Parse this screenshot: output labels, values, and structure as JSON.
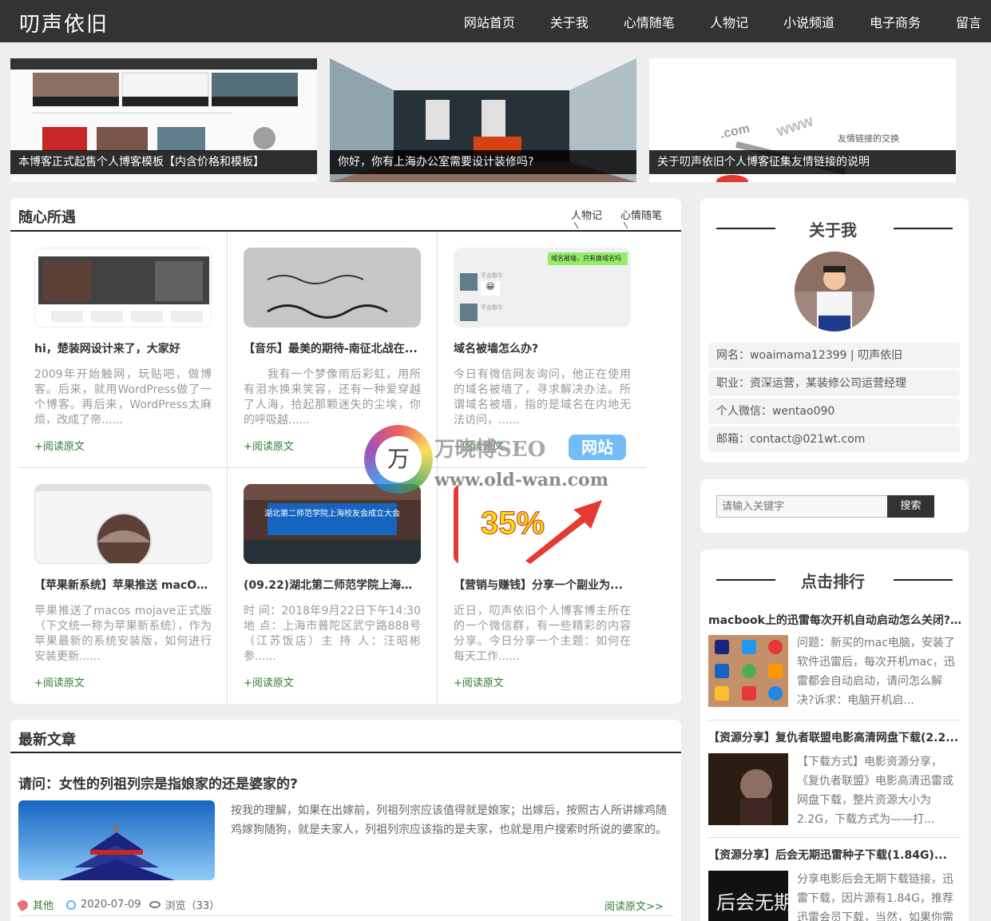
{
  "site": {
    "logo": "叨声依旧"
  },
  "nav": [
    "网站首页",
    "关于我",
    "心情随笔",
    "人物记",
    "小说频道",
    "电子商务",
    "留言"
  ],
  "slides": [
    "本博客正式起售个人博客模板【内含价格和模板】",
    "你好，你有上海办公室需要设计装修吗?",
    "关于叨声依旧个人博客征集友情链接的说明"
  ],
  "slide3_text": {
    "com": ".com",
    "www": "www",
    "label": "友情链接的交换"
  },
  "random": {
    "title": "随心所遇",
    "tabs": [
      "人物记",
      "心情随笔"
    ],
    "read_more": "+阅读原文",
    "cards": [
      {
        "title": "hi，楚装网设计来了，大家好",
        "desc": "2009年开始触网，玩贴吧，做博客。后来，就用WordPress做了一个博客。再后来，WordPress太麻烦，改成了帝......"
      },
      {
        "title": "【音乐】最美的期待-南征北战在...",
        "desc": "　　我有一个梦像雨后彩虹，用所有泪水换来笑容，还有一种爱穿越了人海，拾起那颗迷失的尘埃，你的呼吸越......"
      },
      {
        "title": "域名被墙怎么办?",
        "desc": "今日有微信网友询问，他正在使用的域名被墙了，寻求解决办法。所谓域名被墙，指的是域名在内地无法访问，......"
      },
      {
        "title": "【苹果新系统】苹果推送 macOS...",
        "desc": "苹果推送了macos mojave正式版（下文统一称为苹果新系统），作为苹果最新的系统安装版，如何进行安装更新......"
      },
      {
        "title": "(09.22)湖北第二师范学院上海校...",
        "desc": "时 间：2018年9月22日下午14:30 地 点：上海市普陀区武宁路888号（江苏饭店）主 持 人：汪昭彬 参......"
      },
      {
        "title": "【营销与赚钱】分享一个副业为...",
        "desc": "近日，叨声依旧个人博客博主所在的一个微信群，有一些精彩的内容分享。今日分享一个主题：如何在每天工作......"
      }
    ],
    "chat": {
      "bubble": "域名被墙，只有换域名吗",
      "name1": "不会取牛",
      "name2": "不会取牛",
      "emoji": "😁"
    },
    "temple_banner": "湖北第二师范学院上海校友会成立大会",
    "percent": "35%"
  },
  "latest": {
    "title": "最新文章",
    "post_title": "请问：女性的列祖列宗是指娘家的还是婆家的?",
    "post_desc": "按我的理解，如果在出嫁前，列祖列宗应该值得就是娘家；出嫁后，按照古人所讲嫁鸡随鸡嫁狗随狗，就是夫家人，列祖列宗应该指的是夫家，也就是用户搜索时所说的婆家的。",
    "category": "其他",
    "date": "2020-07-09",
    "views": "浏览（33）",
    "read_more": "阅读原文>>"
  },
  "about": {
    "title": "关于我",
    "rows": [
      "网名：woaimama12399 | 叨声依旧",
      "职业：资深运营，某装修公司运营经理",
      "个人微信：wentao090",
      "邮箱：contact@021wt.com"
    ]
  },
  "search": {
    "placeholder": "请输入关键字",
    "button": "搜索"
  },
  "ranking": {
    "title": "点击排行",
    "items": [
      {
        "title": "macbook上的迅雷每次开机自动启动怎么关闭?...",
        "desc": "问题：新买的mac电脑，安装了软件迅雷后，每次开机mac，迅雷都会自动启动，请问怎么解决?诉求：电脑开机启..."
      },
      {
        "title": "【资源分享】复仇者联盟电影高清网盘下载(2.2...",
        "desc": "【下载方式】电影资源分享，《复仇者联盟》电影高清迅雷或网盘下载，整片资源大小为2.2G，下载方式为——打..."
      },
      {
        "title": "【资源分享】后会无期迅雷种子下载(1.84G)...",
        "desc": "分享电影后会无期下载链接，迅雷下载，因片源有1.84G，推荐迅雷会员下载，当然，如果你需"
      }
    ],
    "movie_text": "后会无期"
  },
  "watermark": {
    "brand": "万晓博SEO",
    "tag": "网站",
    "url": "www.old-wan.com",
    "badge": "万"
  },
  "colors": {
    "header": "#333333",
    "accent": "#e53935",
    "link_green": "#2e7d32"
  }
}
